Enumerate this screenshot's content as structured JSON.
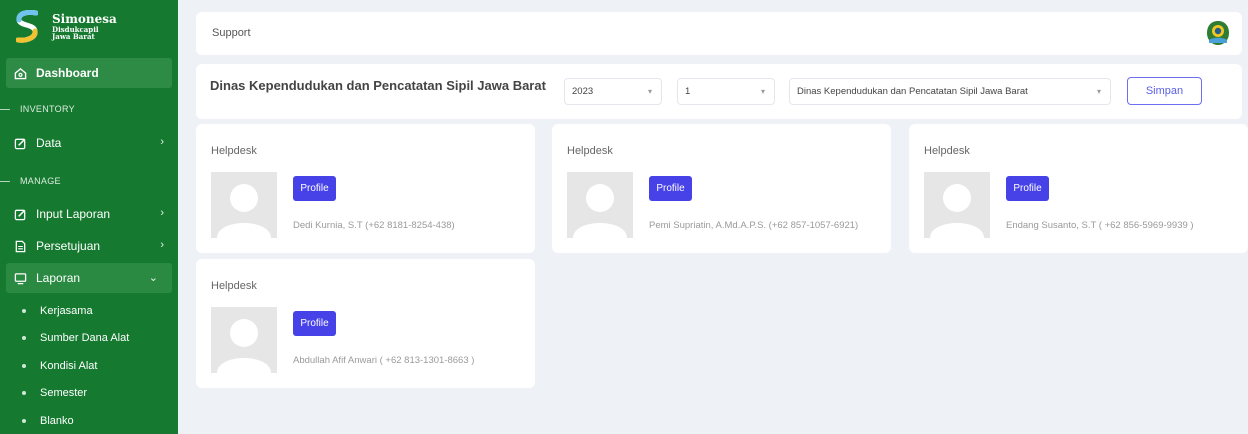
{
  "brand": {
    "name": "Simonesa",
    "sub1": "Disdukcapil",
    "sub2": "Jawa Barat"
  },
  "sidebar": {
    "dashboard": "Dashboard",
    "section_inventory": "INVENTORY",
    "data": "Data",
    "section_manage": "MANAGE",
    "input_laporan": "Input Laporan",
    "persetujuan": "Persetujuan",
    "laporan": "Laporan",
    "laporan_children": [
      "Kerjasama",
      "Sumber Dana Alat",
      "Kondisi Alat",
      "Semester",
      "Blanko"
    ]
  },
  "topbar": {
    "breadcrumb": "Support"
  },
  "filters": {
    "title": "Dinas Kependudukan dan Pencatatan Sipil Jawa Barat",
    "year": "2023",
    "period": "1",
    "agency": "Dinas Kependudukan dan Pencatatan Sipil Jawa Barat",
    "save_label": "Simpan"
  },
  "cards": [
    {
      "title": "Helpdesk",
      "button": "Profile",
      "contact": "Dedi Kurnia, S.T (+62 8181-8254-438)"
    },
    {
      "title": "Helpdesk",
      "button": "Profile",
      "contact": "Pemi Supriatin, A.Md.A.P.S. (+62 857-1057-6921)"
    },
    {
      "title": "Helpdesk",
      "button": "Profile",
      "contact": "Endang Susanto, S.T ( +62 856-5969-9939 )"
    },
    {
      "title": "Helpdesk",
      "button": "Profile",
      "contact": "Abdullah Afif Anwari ( +62 813-1301-8663 )"
    }
  ],
  "colors": {
    "sidebar": "#157a30",
    "primary": "#4741e8",
    "background": "#eef1f6"
  }
}
